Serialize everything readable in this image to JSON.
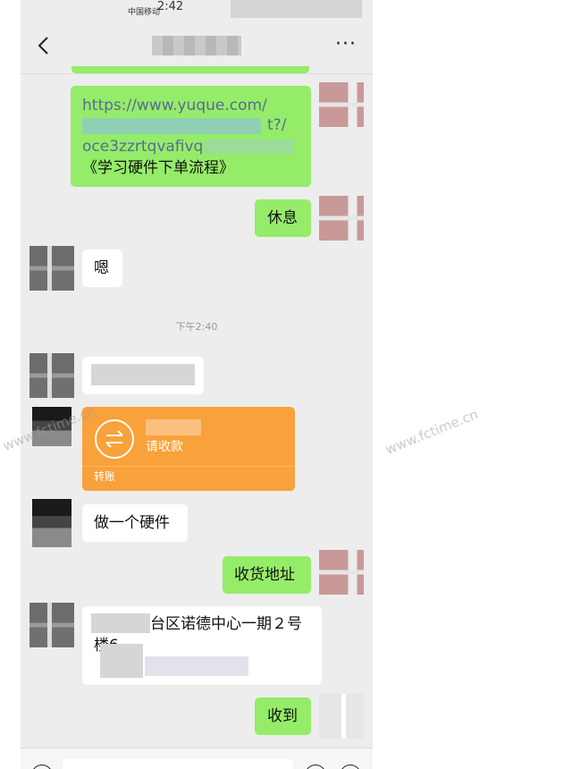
{
  "status_bar": {
    "carrier": "中国移动",
    "time": "2:42"
  },
  "nav": {
    "back_icon": "chevron-left-icon",
    "more_label": "···"
  },
  "messages": {
    "link_line1": "https://www.yuque.com/",
    "link_line2": "t?/",
    "link_line3": "oce3zzrtqvafivqb",
    "link_line4": "《学习硬件下单流程》",
    "rest": "休息",
    "ok": "嗯",
    "timestamp": "下午2:40",
    "transfer_label": "请收款",
    "transfer_footer": "转账",
    "hardware": "做一个硬件",
    "address": "收货地址",
    "addr_line1": "台区诺德中心一期２号",
    "addr_line2": "楼6",
    "received": "收到"
  },
  "watermark": "www.fctime.cn",
  "colors": {
    "green_bubble": "#95ec69",
    "transfer": "#f9a13a",
    "background": "#ededed"
  }
}
